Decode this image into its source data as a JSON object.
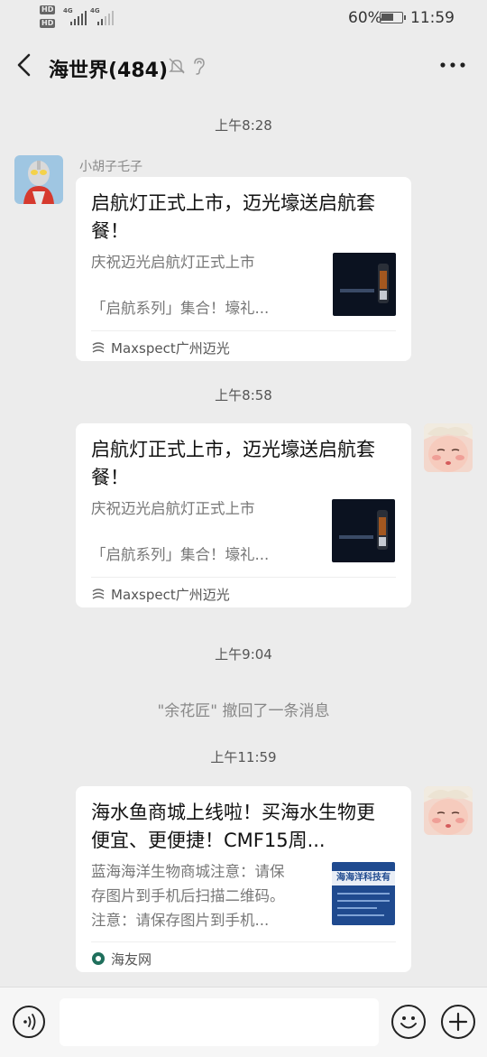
{
  "status_bar": {
    "sim1_badge": "HD",
    "sim2_badge": "HD",
    "net1": "4G",
    "net2": "4G",
    "battery_percent": "60%",
    "battery_level": 0.6,
    "time": "11:59"
  },
  "header": {
    "title": "海世界(484)",
    "icons": [
      "back-arrow-icon",
      "bell-muted-icon",
      "ear-icon",
      "more-icon"
    ]
  },
  "messages": [
    {
      "timestamp": "上午8:28",
      "sender": "小胡子乇子",
      "side": "left",
      "card": {
        "title": "启航灯正式上市，迈光壕送启航套餐！",
        "desc_line1": "庆祝迈光启航灯正式上市",
        "desc_line2": "「启航系列」集合！壕礼...",
        "source": "Maxspect广州迈光"
      }
    },
    {
      "timestamp": "上午8:58",
      "side": "right",
      "card": {
        "title": "启航灯正式上市，迈光壕送启航套餐！",
        "desc_line1": "庆祝迈光启航灯正式上市",
        "desc_line2": "「启航系列」集合！壕礼...",
        "source": "Maxspect广州迈光"
      }
    },
    {
      "timestamp": "上午9:04",
      "recall_notice": "\"余花匠\" 撤回了一条消息"
    },
    {
      "timestamp": "上午11:59",
      "side": "right",
      "card": {
        "title": "海水鱼商城上线啦！买海水生物更便宜、更便捷！CMF15周...",
        "desc_line1": "蓝海海洋生物商城注意：请保",
        "desc_line2": "存图片到手机后扫描二维码。",
        "desc_line3": "注意：请保存图片到手机...",
        "source": "海友网",
        "thumb_text": "海海洋科技有"
      }
    }
  ],
  "input_bar": {
    "placeholder": "",
    "icons": [
      "voice-icon",
      "emoji-icon",
      "plus-icon"
    ]
  },
  "colors": {
    "background": "#ececec",
    "card": "#ffffff",
    "timestamp": "#555555",
    "secondary_text": "#777777"
  }
}
